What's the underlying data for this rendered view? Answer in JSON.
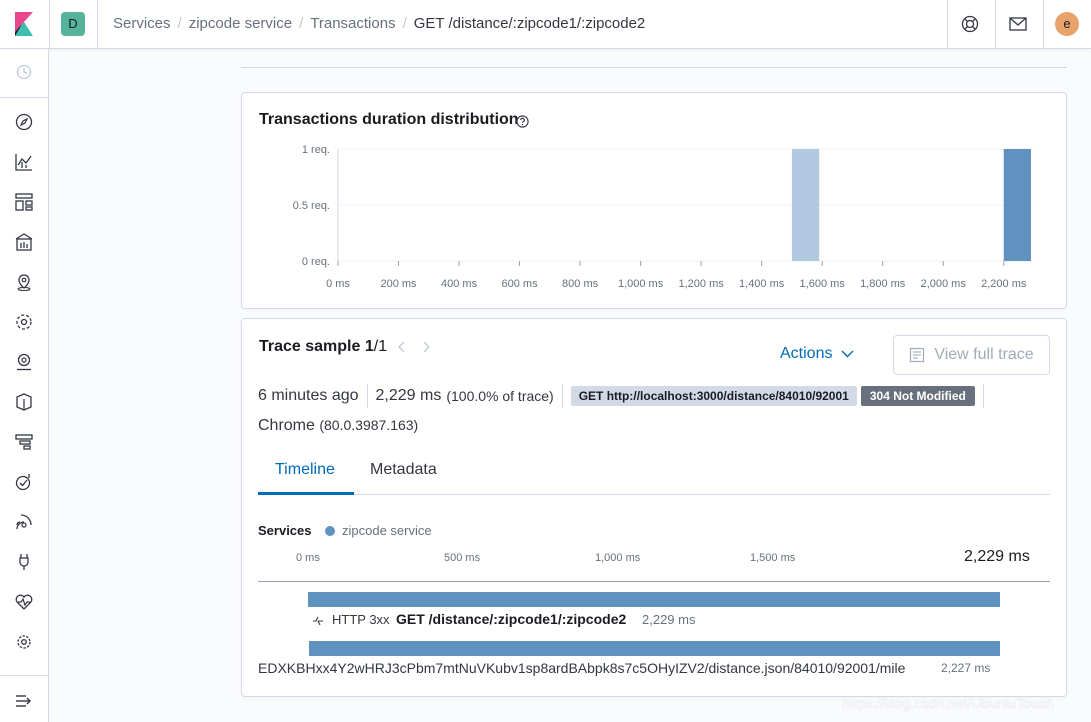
{
  "header": {
    "space_initial": "D",
    "breadcrumbs": [
      "Services",
      "zipcode service",
      "Transactions",
      "GET /distance/:zipcode1/:zipcode2"
    ],
    "user_initial": "e"
  },
  "distribution": {
    "title": "Transactions duration distribution",
    "help_icon": "question-circle-icon"
  },
  "chart_data": {
    "type": "bar",
    "title": "Transactions duration distribution",
    "y_ticks": [
      "1 req.",
      "0.5 req.",
      "0 req."
    ],
    "x_ticks": [
      "0 ms",
      "200 ms",
      "400 ms",
      "600 ms",
      "800 ms",
      "1,000 ms",
      "1,200 ms",
      "1,400 ms",
      "1,600 ms",
      "1,800 ms",
      "2,000 ms",
      "2,200 ms"
    ],
    "xlim": [
      0,
      2300
    ],
    "ylim": [
      0,
      1
    ],
    "bars": [
      {
        "x0": 1500,
        "x1": 1590,
        "value": 1,
        "selected": false
      },
      {
        "x0": 2200,
        "x1": 2290,
        "value": 1,
        "selected": true
      }
    ],
    "colors": {
      "bar": "#b0c9e0",
      "selected": "#6092c0",
      "grid": "#eef0f3"
    }
  },
  "trace": {
    "title_prefix": "Trace sample ",
    "title_index": "1",
    "title_total": "/1",
    "actions_label": "Actions",
    "view_full_trace_label": "View full trace",
    "time_ago": "6 minutes ago",
    "duration": "2,229 ms",
    "duration_pct": "(100.0% of trace)",
    "url_badge": "GET http://localhost:3000/distance/84010/92001",
    "status_badge": "304 Not Modified",
    "browser": "Chrome",
    "browser_version": "(80.0.3987.163)",
    "tabs": [
      "Timeline",
      "Metadata"
    ]
  },
  "timeline": {
    "services_label": "Services",
    "service_name": "zipcode service",
    "service_color": "#6092c0",
    "ticks": [
      "0 ms",
      "500 ms",
      "1,000 ms",
      "1,500 ms"
    ],
    "total": "2,229 ms",
    "spans": [
      {
        "type": "HTTP 3xx",
        "name": "GET /distance/:zipcode1/:zipcode2",
        "duration": "2,229 ms",
        "fraction": 1.0
      },
      {
        "type": "",
        "name": "EDXKBHxx4Y2wHRJ3cPbm7mtNuVKubv1sp8ardBAbpk8s7c5OHyIZV2/distance.json/84010/92001/mile",
        "duration": "2,227 ms",
        "fraction": 0.999
      }
    ]
  },
  "watermark": "https://blog.csdn.net/UbuntuTouch"
}
